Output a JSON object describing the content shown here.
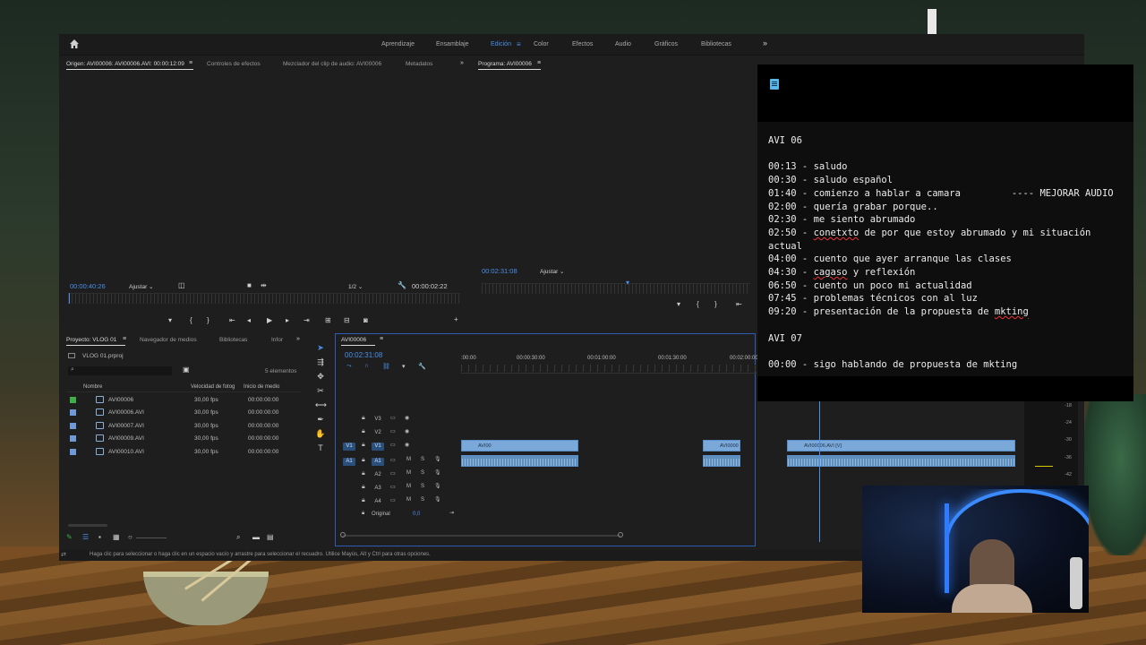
{
  "workspaces": {
    "tabs": [
      "Aprendizaje",
      "Ensamblaje",
      "Edición",
      "Color",
      "Efectos",
      "Audio",
      "Gráficos",
      "Bibliotecas"
    ],
    "active": "Edición"
  },
  "source_monitor": {
    "tabs": [
      "Origen: AVI00006: AVI00006.AVI: 00:00:12:09",
      "Controles de efectos",
      "Mezclador del clip de audio: AVI00006",
      "Metadatos"
    ],
    "timecode": "00:00:40:26",
    "fit": "Ajustar",
    "resolution": "1/2",
    "duration": "00:00:02:22"
  },
  "program_monitor": {
    "title": "Programa: AVI00006",
    "timecode": "00:02:31:08",
    "fit": "Ajustar"
  },
  "project": {
    "tabs": [
      "Proyecto: VLOG 01",
      "Navegador de medios",
      "Bibliotecas",
      "Infor"
    ],
    "file": "VLOG 01.prproj",
    "count": "5 elementos",
    "columns": [
      "Nombre",
      "Velocidad de fotog",
      "Inicio de medio"
    ],
    "rows": [
      {
        "name": "AVI00006",
        "fps": "30,00 fps",
        "start": "00:00:00:00",
        "color": "#3fae49"
      },
      {
        "name": "AVI00006.AVI",
        "fps": "30,00 fps",
        "start": "00:00:00:00",
        "color": "#6f9ad8"
      },
      {
        "name": "AVI00007.AVI",
        "fps": "30,00 fps",
        "start": "00:00:00:00",
        "color": "#6f9ad8"
      },
      {
        "name": "AVI00009.AVI",
        "fps": "30,00 fps",
        "start": "00:00:00:00",
        "color": "#6f9ad8"
      },
      {
        "name": "AVI00010.AVI",
        "fps": "30,00 fps",
        "start": "00:00:00:00",
        "color": "#6f9ad8"
      }
    ]
  },
  "timeline": {
    "sequence": "AVI00006",
    "timecode": "00:02:31:08",
    "ruler": [
      ":00:00",
      "00:00:30:00",
      "00:01:00:00",
      "00:01:30:00",
      "00:02:00:00"
    ],
    "tracks": [
      "V3",
      "V2",
      "V1",
      "A1",
      "A2",
      "A3",
      "A4"
    ],
    "src_labels": [
      "V1",
      "A1"
    ],
    "mix_label": "Original",
    "mix_value": "0,0",
    "clips": [
      "AVI00",
      "AVI0000",
      "AVI00006.AVI [V]"
    ],
    "meter": [
      "-18",
      "-24",
      "-30",
      "-36",
      "-42"
    ]
  },
  "status": {
    "text": "Haga clic para seleccionar o haga clic en un espacio vacío y arrastre para seleccionar el recuadro. Utilice Mayús, Alt y Ctrl para otras opciones."
  },
  "notes": {
    "title1": "AVI 06",
    "lines": [
      {
        "t": "00:13",
        "text": "saludo"
      },
      {
        "t": "00:30",
        "text": "saludo español"
      },
      {
        "t": "01:40",
        "text": "comienzo a hablar a camara         ---- MEJORAR AUDIO"
      },
      {
        "t": "02:00",
        "text": "quería grabar porque.."
      },
      {
        "t": "02:30",
        "text": "me siento abrumado"
      },
      {
        "t": "02:50",
        "pre": "",
        "spell": "conetxto",
        "post": " de por que estoy abrumado y mi situación actual"
      },
      {
        "t": "04:00",
        "text": "cuento que ayer arranque las clases"
      },
      {
        "t": "04:30",
        "pre": "",
        "spell": "cagaso",
        "post": " y reflexión"
      },
      {
        "t": "06:50",
        "text": "cuento un poco mi actualidad"
      },
      {
        "t": "07:45",
        "text": "problemas técnicos con al luz"
      },
      {
        "t": "09:20",
        "pre": "presentación de la propuesta de ",
        "spell": "mkting",
        "post": ""
      }
    ],
    "title2": "AVI 07",
    "cut_line": "00:00 - sigo hablando de propuesta de mkting"
  }
}
